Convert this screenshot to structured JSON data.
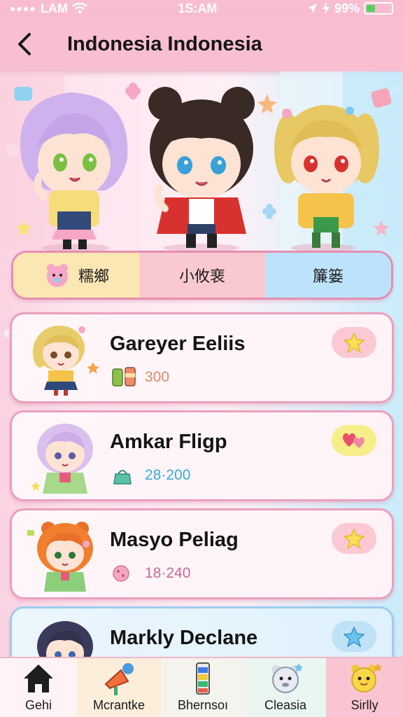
{
  "status_bar": {
    "carrier": "LAM",
    "time": "1S:AM",
    "battery": "99%"
  },
  "header": {
    "title": "Indonesia Indonesia"
  },
  "tabs": [
    {
      "label": "糯鄉"
    },
    {
      "label": "小攸裵"
    },
    {
      "label": "簾篓"
    }
  ],
  "characters": [
    {
      "name": "Gareyer Eeliis",
      "stat": "300",
      "stat_color": "#d98a6a",
      "fav_icon": "star-icon",
      "fav_bg": "#fbc9d3"
    },
    {
      "name": "Amkar Fligp",
      "stat": "28·200",
      "stat_color": "#3aa9d8",
      "fav_icon": "hearts-icon",
      "fav_bg": "#f7ee8a"
    },
    {
      "name": "Masyo Peliag",
      "stat": "18·240",
      "stat_color": "#c86a93",
      "fav_icon": "star-icon",
      "fav_bg": "#fbc9d3"
    },
    {
      "name": "Markly Declane",
      "stat": "",
      "stat_color": "#333333",
      "fav_icon": "star-icon",
      "fav_bg": "#bfe2f7"
    }
  ],
  "bottom_nav": [
    {
      "label": "Gehi",
      "icon": "home-icon",
      "bg": "#fff3f6"
    },
    {
      "label": "Mcrantke",
      "icon": "megaphone-icon",
      "bg": "#fdeedb"
    },
    {
      "label": "Bhernsoı",
      "icon": "battery-icon",
      "bg": "#f5f3ee"
    },
    {
      "label": "Cleasia",
      "icon": "bear-icon",
      "bg": "#e9f7f0"
    },
    {
      "label": "Sirlly",
      "icon": "sun-face-icon",
      "bg": "#fac5d3"
    }
  ],
  "colors": {
    "header_bg": "#f8bfd2",
    "card_border": "#eaa0bc",
    "accent_pink": "#e58eb0"
  }
}
